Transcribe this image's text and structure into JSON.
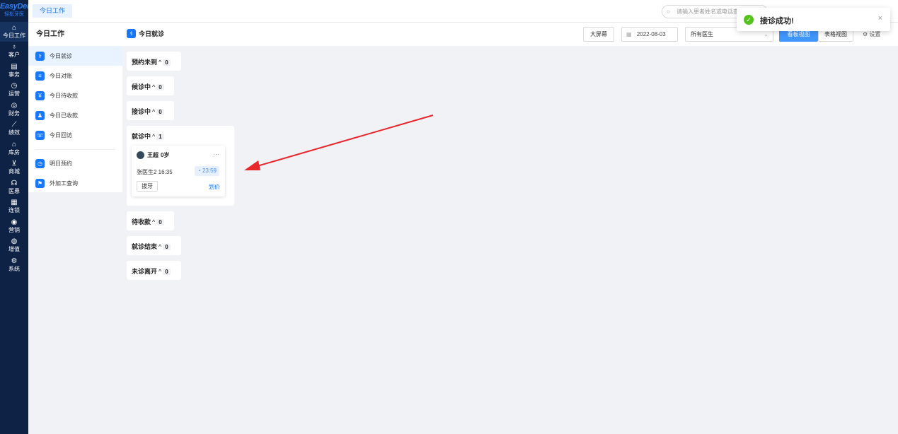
{
  "brand": {
    "line1": "EasyDent",
    "line2": "轻松牙医"
  },
  "nav": [
    {
      "icon": "⌂",
      "label": "今日工作",
      "name": "home-icon"
    },
    {
      "icon": "♁",
      "label": "客户",
      "name": "user-icon"
    },
    {
      "icon": "▤",
      "label": "事务",
      "name": "task-icon"
    },
    {
      "icon": "◷",
      "label": "运营",
      "name": "clock-icon"
    },
    {
      "icon": "◎",
      "label": "财务",
      "name": "finance-icon"
    },
    {
      "icon": "⟋",
      "label": "绩效",
      "name": "chart-icon"
    },
    {
      "icon": "⌂",
      "label": "库房",
      "name": "warehouse-icon"
    },
    {
      "icon": "⊻",
      "label": "商城",
      "name": "cart-icon"
    },
    {
      "icon": "☊",
      "label": "医患",
      "name": "doctor-patient-icon"
    },
    {
      "icon": "▦",
      "label": "连锁",
      "name": "chain-icon"
    },
    {
      "icon": "◉",
      "label": "营销",
      "name": "marketing-icon"
    },
    {
      "icon": "◍",
      "label": "增值",
      "name": "value-added-icon"
    },
    {
      "icon": "⚙",
      "label": "系统",
      "name": "gear-icon"
    }
  ],
  "topbar": {
    "tab": "今日工作",
    "search_placeholder": "请输入患者姓名或电话查询"
  },
  "sidebar": {
    "title": "今日工作",
    "items": [
      {
        "icon": "⚕",
        "label": "今日就诊"
      },
      {
        "icon": "≡",
        "label": "今日对账"
      },
      {
        "icon": "¥",
        "label": "今日待收款"
      },
      {
        "icon": "♟",
        "label": "今日已收款"
      },
      {
        "icon": "☏",
        "label": "今日回访"
      }
    ],
    "items2": [
      {
        "icon": "◷",
        "label": "明日预约"
      },
      {
        "icon": "⚑",
        "label": "外加工查询"
      }
    ]
  },
  "main": {
    "title": "今日就诊",
    "big_screen": "大屏幕",
    "date_icon": "▦",
    "date": "2022-08-03",
    "doctor_select": "所有医生",
    "view_board": "看板视图",
    "view_table": "表格视图",
    "settings": "设置",
    "caret": "^"
  },
  "columns": [
    {
      "label": "预约未到",
      "count": "0"
    },
    {
      "label": "候诊中",
      "count": "0"
    },
    {
      "label": "接诊中",
      "count": "0"
    },
    {
      "label": "就诊中",
      "count": "1"
    },
    {
      "label": "待收款",
      "count": "0"
    },
    {
      "label": "就诊结束",
      "count": "0"
    },
    {
      "label": "未诊离开",
      "count": "0"
    }
  ],
  "card": {
    "name": "王超",
    "age": "0岁",
    "more": "···",
    "doctor_time": "张医生2  16:35",
    "timer": "23:59",
    "tag": "拔牙",
    "price_link": "划价"
  },
  "toast": {
    "message": "接诊成功!",
    "close": "×",
    "check": "✓"
  },
  "colors": {
    "nav_bg": "#0e2245",
    "accent": "#1677ff",
    "success": "#52c41a",
    "arrow": "#e8262c"
  }
}
